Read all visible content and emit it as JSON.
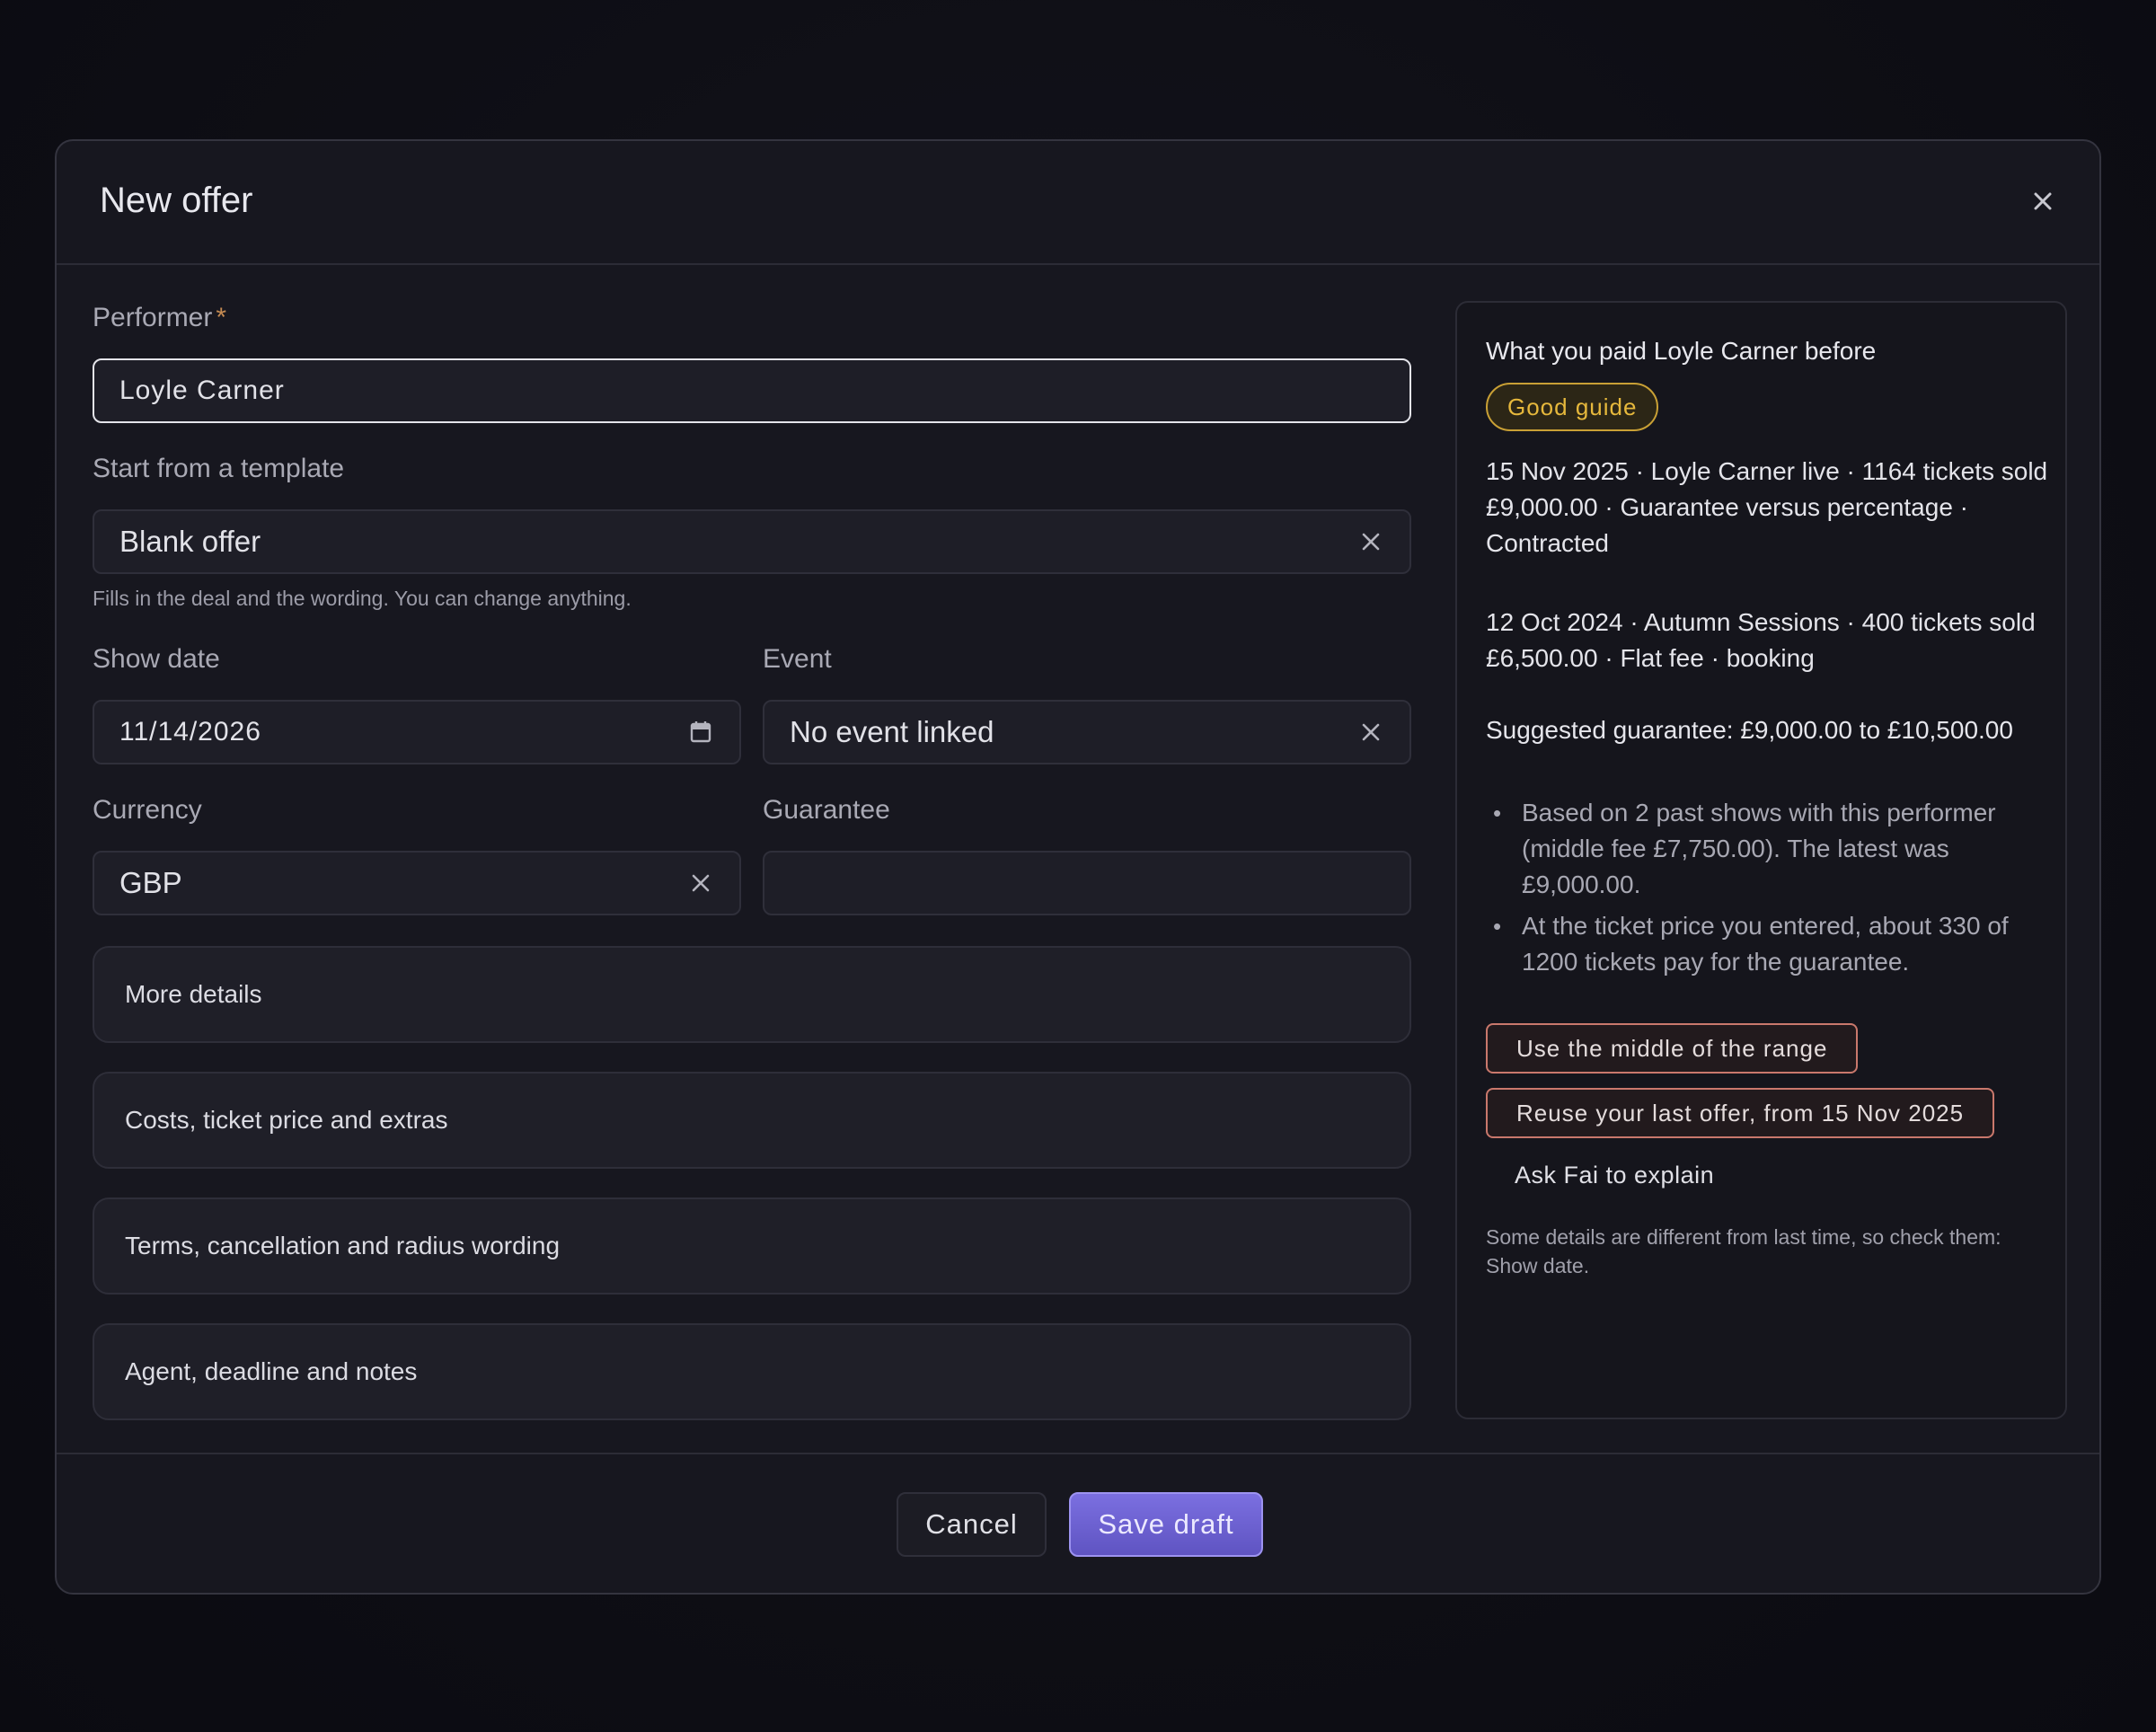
{
  "modal": {
    "title": "New offer"
  },
  "form": {
    "performer": {
      "label": "Performer",
      "required_mark": "*",
      "value": "Loyle Carner"
    },
    "template": {
      "label": "Start from a template",
      "value": "Blank offer",
      "helper": "Fills in the deal and the wording. You can change anything."
    },
    "show_date": {
      "label": "Show date",
      "value": "11/14/2026"
    },
    "event": {
      "label": "Event",
      "value": "No event linked"
    },
    "currency": {
      "label": "Currency",
      "value": "GBP"
    },
    "guarantee": {
      "label": "Guarantee",
      "value": ""
    }
  },
  "sections": [
    {
      "label": "More details"
    },
    {
      "label": "Costs, ticket price and extras"
    },
    {
      "label": "Terms, cancellation and radius wording"
    },
    {
      "label": "Agent, deadline and notes"
    }
  ],
  "side_panel": {
    "title": "What you paid Loyle Carner before",
    "badge": "Good guide",
    "history": [
      {
        "line1": "15 Nov 2025 · Loyle Carner live · 1164 tickets sold",
        "line2": "£9,000.00 · Guarantee versus percentage · Contracted"
      },
      {
        "line1": "12 Oct 2024 · Autumn Sessions · 400 tickets sold",
        "line2": "£6,500.00 · Flat fee · booking"
      }
    ],
    "suggestion": "Suggested guarantee: £9,000.00 to £10,500.00",
    "bullets": [
      "Based on 2 past shows with this performer (middle fee £7,750.00). The latest was £9,000.00.",
      "At the ticket price you entered, about 330 of 1200 tickets pay for the guarantee."
    ],
    "use_middle_label": "Use the middle of the range",
    "reuse_label": "Reuse your last offer, from 15 Nov 2025",
    "ask_label": "Ask Fai to explain",
    "note": "Some details are different from last time, so check them: Show date."
  },
  "footer": {
    "cancel_label": "Cancel",
    "save_label": "Save draft"
  },
  "colors": {
    "accent": "#6c62d4",
    "badge": "#e6b83c",
    "action_border": "#c9786c"
  }
}
